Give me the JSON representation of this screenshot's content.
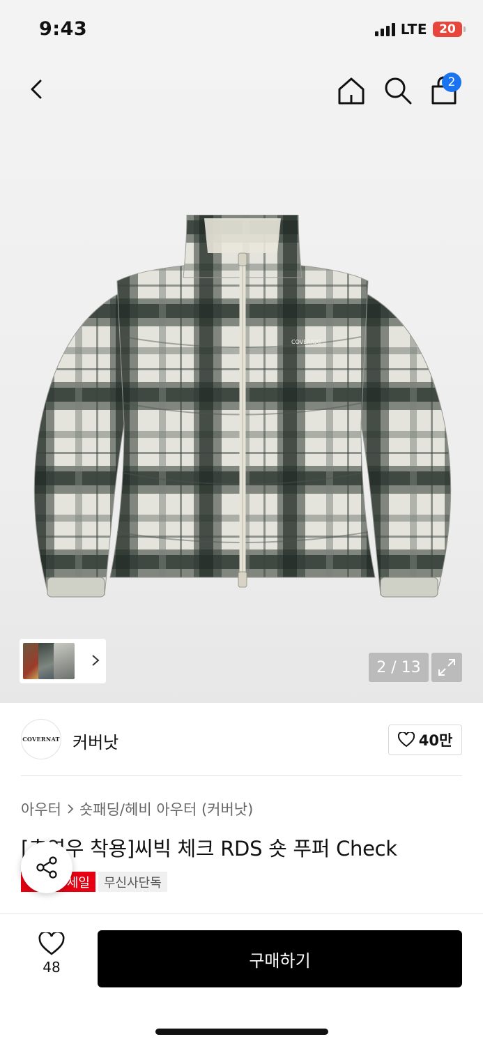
{
  "status_bar": {
    "time": "9:43",
    "network": "LTE",
    "battery": "20"
  },
  "nav": {
    "back_icon": "chevron-left-icon",
    "home_icon": "home-icon",
    "search_icon": "search-icon",
    "cart_icon": "shopping-bag-icon",
    "cart_count": "2"
  },
  "gallery": {
    "counter": "2 / 13",
    "expand_icon": "expand-icon",
    "brand_print": "COVERNAT"
  },
  "brand": {
    "logo_text": "COVERNAT",
    "name": "커버낫",
    "likes": "40만"
  },
  "breadcrumb": {
    "category": "아우터",
    "subcategory": "숏패딩/헤비 아우터 (커버낫)"
  },
  "product": {
    "title": "[추영우 착용]씨빅 체크 RDS 숏 푸퍼 Check",
    "tags": [
      "세일",
      "무신사단독"
    ]
  },
  "bottom_bar": {
    "wish_count": "48",
    "buy_label": "구매하기"
  },
  "colors": {
    "accent_blue": "#1a73f0",
    "sale_red": "#e60012",
    "battery_red": "#e8463d",
    "buy_black": "#000000"
  }
}
